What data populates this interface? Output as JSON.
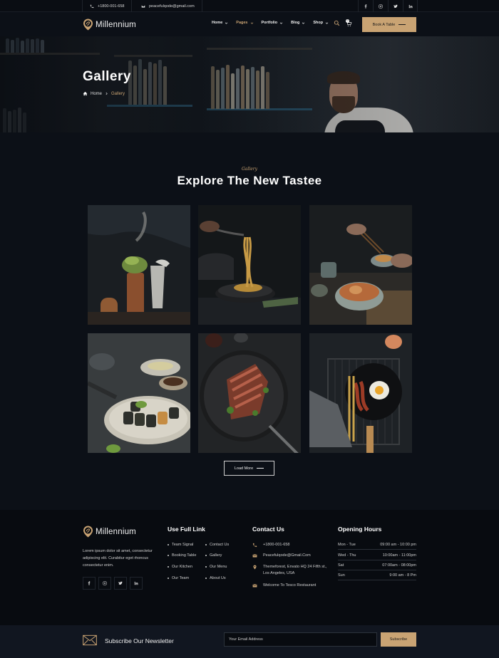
{
  "topbar": {
    "phone": "+1800-001-658",
    "email": "peacefulqode@gmail.com",
    "socials": [
      "facebook-icon",
      "instagram-icon",
      "twitter-icon",
      "linkedin-icon"
    ]
  },
  "header": {
    "logo_text": "Millennium",
    "nav": [
      {
        "label": "Home",
        "active": false
      },
      {
        "label": "Pages",
        "active": true
      },
      {
        "label": "Portfolio",
        "active": false
      },
      {
        "label": "Blog",
        "active": false
      },
      {
        "label": "Shop",
        "active": false
      }
    ],
    "cart_count": "0",
    "book_button": "Book A Table"
  },
  "hero": {
    "title": "Gallery",
    "breadcrumb_home": "Home",
    "breadcrumb_current": "Gallery"
  },
  "gallery": {
    "subtitle": "Gallery",
    "title": "Explore The New Tastee",
    "load_more": "Load More"
  },
  "footer": {
    "logo_text": "Millennium",
    "about": "Lorem ipsum dolor sit amet, consectetur adipiscing elit. Curabitur eget rhoncus consectetur enim.",
    "links_heading": "Use Full Link",
    "links": [
      "Team Signal",
      "Booking Table",
      "Our Kitchen",
      "Our Team",
      "Contact Us",
      "Gallery",
      "Our Menu",
      "About Us"
    ],
    "contact_heading": "Contact Us",
    "contact": {
      "phone": "+1800-001-658",
      "email": "Peacefulqode@Gmail.Com",
      "address": "Themeforest, Envato HQ 24 Fifth st., Los Angeles, USA",
      "welcome": "Welcome To Tesco Restaurant"
    },
    "hours_heading": "Opening Hours",
    "hours": [
      {
        "day": "Mon - Tue",
        "time": "09:00 am - 10:00 pm"
      },
      {
        "day": "Wed - Thu",
        "time": "10:00am - 11:00pm"
      },
      {
        "day": "Sat",
        "time": "07:00am - 08:00pm"
      },
      {
        "day": "Sun",
        "time": "9:00 am - 8 Pm"
      }
    ]
  },
  "newsletter": {
    "label": "Subscribe Our Newsletter",
    "placeholder": "Your Email Address",
    "button": "Subscribe"
  },
  "colors": {
    "accent": "#c9a373",
    "background": "#0c1017",
    "footer": "#080b10"
  }
}
